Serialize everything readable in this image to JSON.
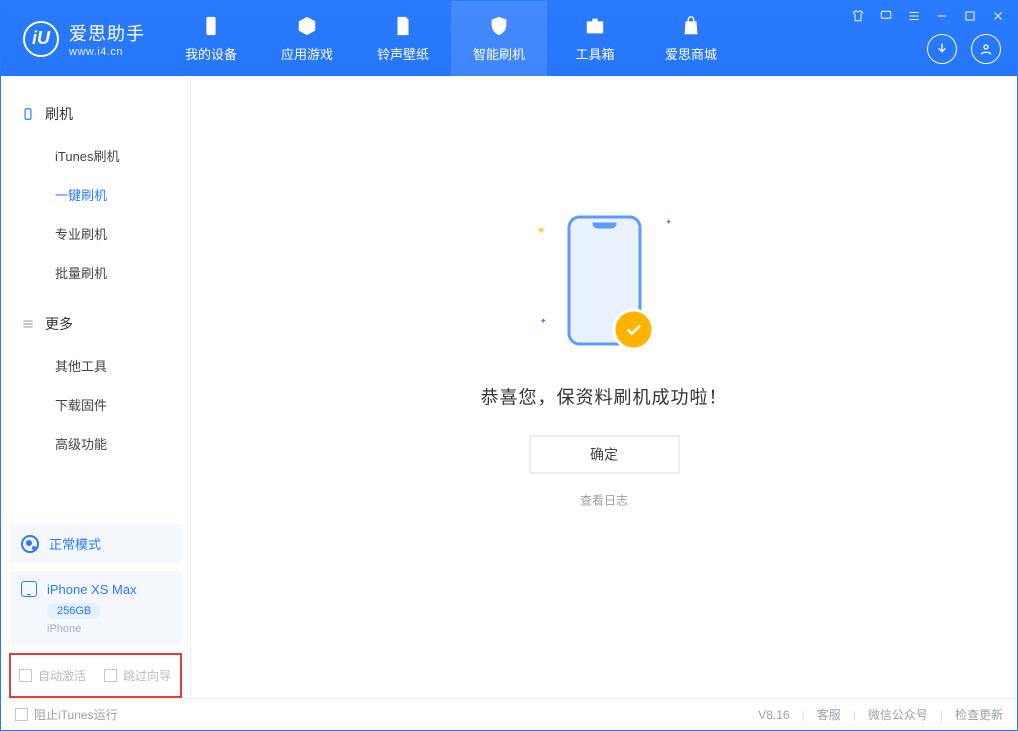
{
  "app": {
    "name": "爱思助手",
    "subtitle": "www.i4.cn"
  },
  "tabs": {
    "device": "我的设备",
    "apps": "应用游戏",
    "ringtones": "铃声壁纸",
    "flash": "智能刷机",
    "toolbox": "工具箱",
    "store": "爱思商城"
  },
  "sidebar": {
    "group_flash": "刷机",
    "itunes_flash": "iTunes刷机",
    "oneclick_flash": "一键刷机",
    "pro_flash": "专业刷机",
    "batch_flash": "批量刷机",
    "group_more": "更多",
    "other_tools": "其他工具",
    "download_fw": "下载固件",
    "advanced": "高级功能"
  },
  "mode": {
    "label": "正常模式"
  },
  "device": {
    "name": "iPhone XS Max",
    "storage": "256GB",
    "type": "iPhone"
  },
  "options": {
    "auto_activate": "自动激活",
    "skip_guide": "跳过向导"
  },
  "result": {
    "message": "恭喜您，保资料刷机成功啦！",
    "ok": "确定",
    "view_log": "查看日志"
  },
  "footer": {
    "block_itunes": "阻止iTunes运行",
    "version": "V8.16",
    "support": "客服",
    "wechat": "微信公众号",
    "check_update": "检查更新"
  }
}
